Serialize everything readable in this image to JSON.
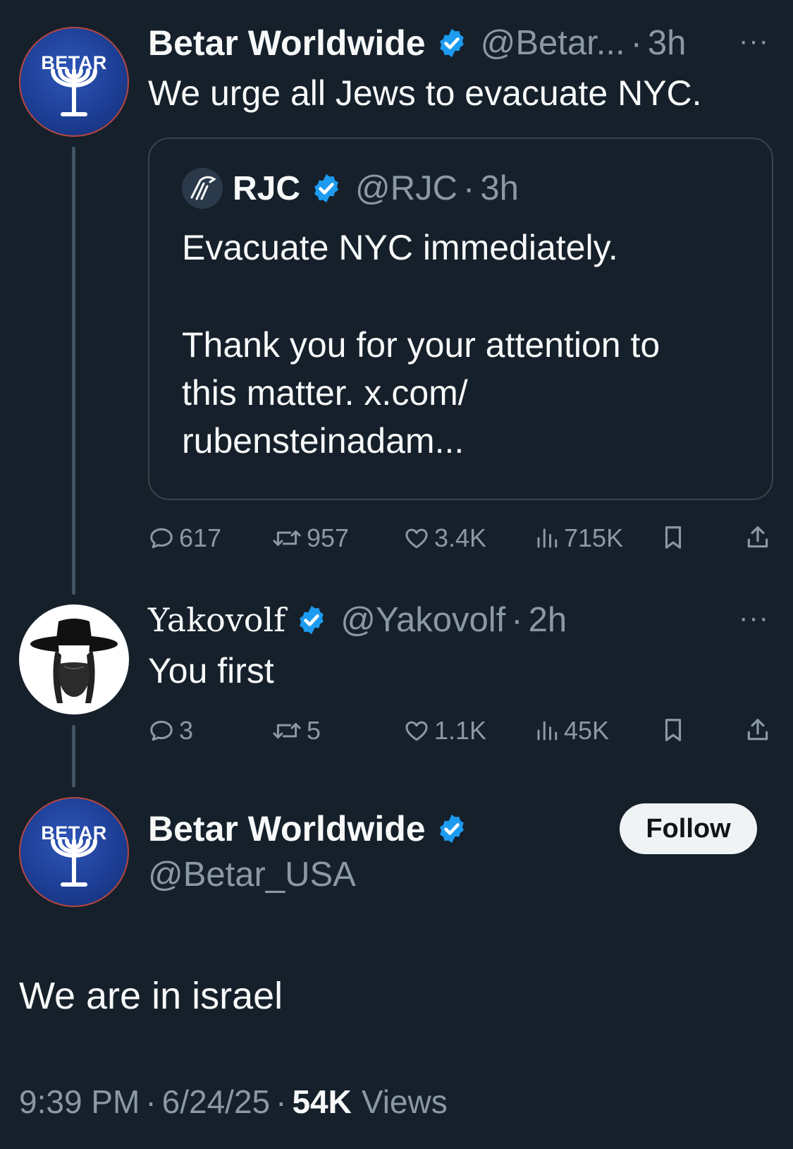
{
  "thread": [
    {
      "author": {
        "display_name": "Betar Worldwide",
        "handle": "@Betar...",
        "time": "3h",
        "verified": true,
        "avatar_text": "BETAR"
      },
      "text": "We urge all Jews to evacuate NYC.",
      "quote": {
        "author": {
          "display_name": "RJC",
          "handle": "@RJC",
          "time": "3h",
          "verified": true
        },
        "line1": "Evacuate NYC immediately.",
        "line2": "Thank you for your attention to",
        "line3": "this matter. x.com/",
        "line4": "rubensteinadam..."
      },
      "stats": {
        "replies": "617",
        "reposts": "957",
        "likes": "3.4K",
        "views": "715K"
      }
    },
    {
      "author": {
        "display_name": "Yakovolf",
        "handle": "@Yakovolf",
        "time": "2h",
        "verified": true
      },
      "text": "You first",
      "stats": {
        "replies": "3",
        "reposts": "5",
        "likes": "1.1K",
        "views": "45K"
      }
    }
  ],
  "main_post": {
    "author": {
      "display_name": "Betar Worldwide",
      "handle": "@Betar_USA",
      "verified": true,
      "avatar_text": "BETAR"
    },
    "follow_label": "Follow",
    "text": "We are in israel",
    "time": "9:39 PM",
    "date": "6/24/25",
    "views_count": "54K",
    "views_label": "Views"
  },
  "separator": "·",
  "more_glyph": "···",
  "colors": {
    "background": "#15202b",
    "secondary_text": "#8b98a5",
    "verified_blue": "#1d9bf0",
    "thread_line": "#425364"
  }
}
